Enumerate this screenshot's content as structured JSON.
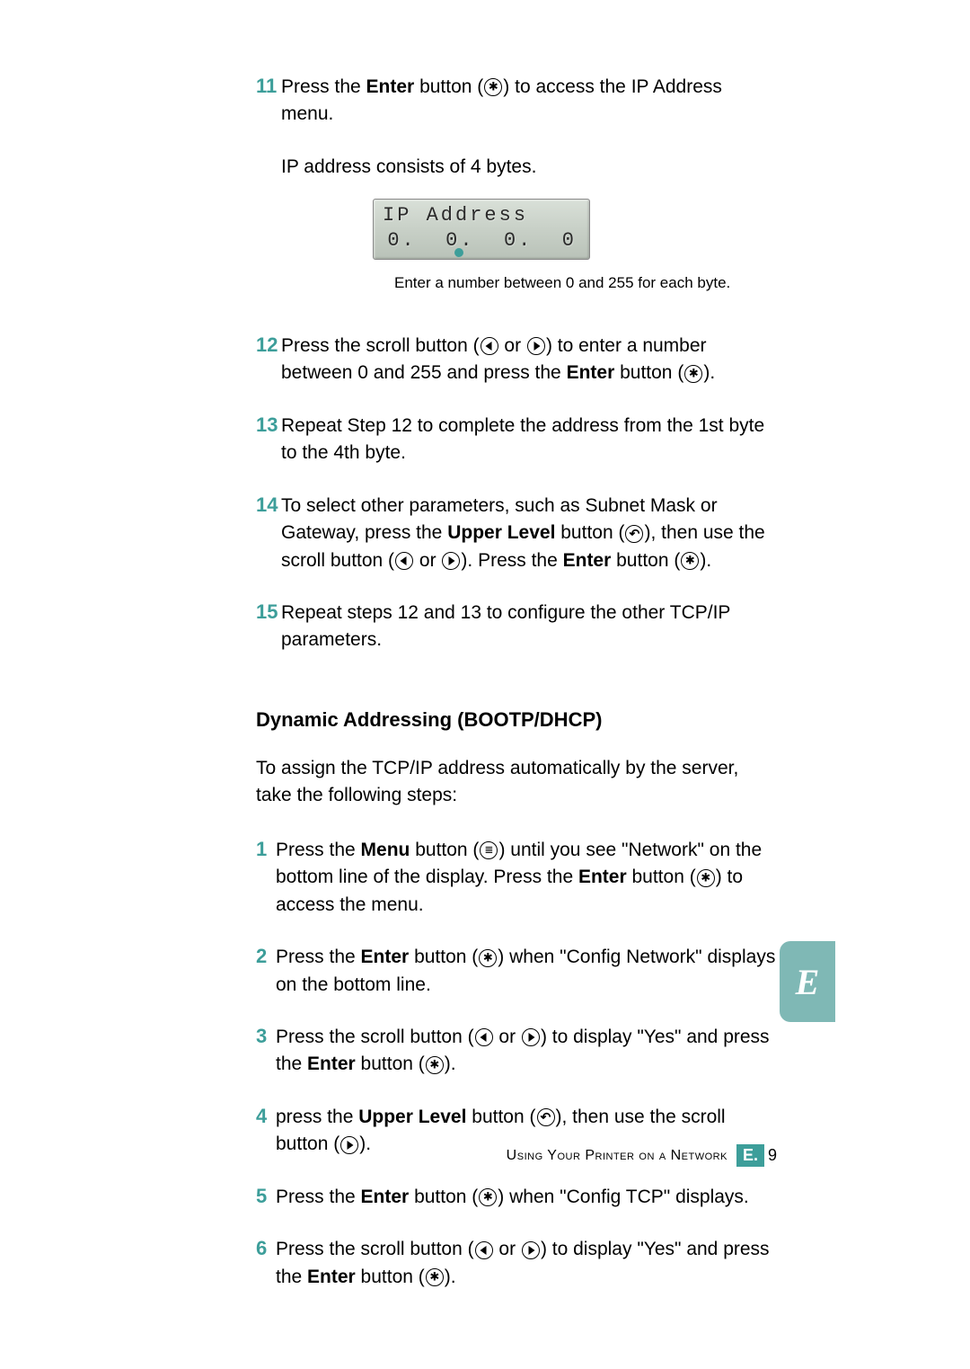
{
  "steps_a": [
    {
      "num": "11",
      "parts": [
        {
          "t": "Press the "
        },
        {
          "t": "Enter",
          "b": true
        },
        {
          "t": " button ("
        },
        {
          "icon": "enter"
        },
        {
          "t": ") to access the IP Address menu."
        }
      ]
    }
  ],
  "indent_text": "IP address consists of 4 bytes.",
  "lcd": {
    "line1": "IP Address",
    "line2": "0.  0.  0.  0"
  },
  "lcd_caption": "Enter a number between 0 and 255 for each byte.",
  "steps_b": [
    {
      "num": "12",
      "parts": [
        {
          "t": "Press the scroll button ("
        },
        {
          "icon": "left"
        },
        {
          "t": " or "
        },
        {
          "icon": "right"
        },
        {
          "t": ") to enter a number between 0 and 255 and press the "
        },
        {
          "t": "Enter",
          "b": true
        },
        {
          "t": " button ("
        },
        {
          "icon": "enter"
        },
        {
          "t": ")."
        }
      ]
    },
    {
      "num": "13",
      "parts": [
        {
          "t": "Repeat Step 12 to complete the address from the 1st byte to the 4th byte."
        }
      ]
    },
    {
      "num": "14",
      "parts": [
        {
          "t": "To select other parameters, such as Subnet Mask or Gateway, press the "
        },
        {
          "t": "Upper Level",
          "b": true
        },
        {
          "t": " button ("
        },
        {
          "icon": "upper"
        },
        {
          "t": "), then use the scroll button ("
        },
        {
          "icon": "left"
        },
        {
          "t": " or "
        },
        {
          "icon": "right"
        },
        {
          "t": "). Press the "
        },
        {
          "t": "Enter",
          "b": true
        },
        {
          "t": " button ("
        },
        {
          "icon": "enter"
        },
        {
          "t": ")."
        }
      ]
    },
    {
      "num": "15",
      "parts": [
        {
          "t": "Repeat steps  12 and 13 to configure the other TCP/IP parameters."
        }
      ]
    }
  ],
  "section_heading": "Dynamic Addressing (BOOTP/DHCP)",
  "section_intro": "To assign the TCP/IP address automatically by the server, take the following steps:",
  "steps_c": [
    {
      "num": "1",
      "parts": [
        {
          "t": "Press the "
        },
        {
          "t": "Menu",
          "b": true
        },
        {
          "t": " button ("
        },
        {
          "icon": "menu"
        },
        {
          "t": ") until you see \"Network\" on the bottom line of the display. Press the "
        },
        {
          "t": "Enter",
          "b": true
        },
        {
          "t": " button ("
        },
        {
          "icon": "enter"
        },
        {
          "t": ") to access the menu."
        }
      ]
    },
    {
      "num": "2",
      "parts": [
        {
          "t": "Press the "
        },
        {
          "t": "Enter",
          "b": true
        },
        {
          "t": " button ("
        },
        {
          "icon": "enter"
        },
        {
          "t": ") when \"Config Network\" displays on the bottom line."
        }
      ]
    },
    {
      "num": "3",
      "parts": [
        {
          "t": "Press the scroll button ("
        },
        {
          "icon": "left"
        },
        {
          "t": " or "
        },
        {
          "icon": "right"
        },
        {
          "t": ") to display \"Yes\" and press the "
        },
        {
          "t": "Enter",
          "b": true
        },
        {
          "t": " button ("
        },
        {
          "icon": "enter"
        },
        {
          "t": ")."
        }
      ]
    },
    {
      "num": "4",
      "parts": [
        {
          "t": "press the "
        },
        {
          "t": "Upper Level",
          "b": true
        },
        {
          "t": " button ("
        },
        {
          "icon": "upper"
        },
        {
          "t": "), then use the scroll button ("
        },
        {
          "icon": "right"
        },
        {
          "t": ")."
        }
      ]
    },
    {
      "num": "5",
      "parts": [
        {
          "t": "Press the "
        },
        {
          "t": "Enter",
          "b": true
        },
        {
          "t": " button ("
        },
        {
          "icon": "enter"
        },
        {
          "t": ") when \"Config TCP\" displays."
        }
      ]
    },
    {
      "num": "6",
      "parts": [
        {
          "t": "Press the scroll button ("
        },
        {
          "icon": "left"
        },
        {
          "t": " or "
        },
        {
          "icon": "right"
        },
        {
          "t": ") to display \"Yes\" and press the "
        },
        {
          "t": "Enter",
          "b": true
        },
        {
          "t": " button ("
        },
        {
          "icon": "enter"
        },
        {
          "t": ")."
        }
      ]
    }
  ],
  "side_tab": "E",
  "footer": {
    "text": "Using Your Printer on a Network",
    "section": "E.",
    "page": "9"
  }
}
